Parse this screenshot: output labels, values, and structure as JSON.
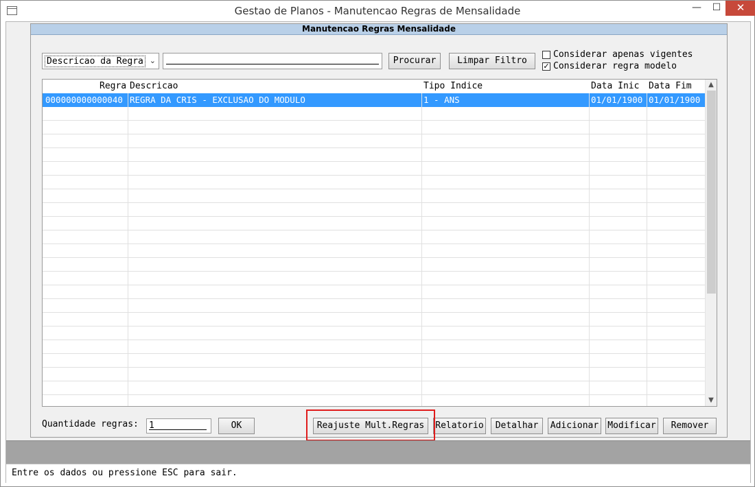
{
  "window": {
    "title": "Gestao de Planos - Manutencao Regras de Mensalidade",
    "min_glyph": "—",
    "max_glyph": "☐",
    "close_glyph": "✕"
  },
  "panel": {
    "title": "Manutencao Regras Mensalidade"
  },
  "filter": {
    "field_selected": "Descricao da Regra",
    "dropdown_glyph": "⌄",
    "search_value": "",
    "search_button": "Procurar",
    "clear_button": "Limpar Filtro",
    "only_current_label": "Considerar apenas vigentes",
    "only_current_checked": false,
    "model_rule_label": "Considerar regra modelo",
    "model_rule_checked": true,
    "check_glyph": "✓"
  },
  "grid": {
    "columns": [
      "Regra",
      "Descricao",
      "Tipo Indice",
      "Data Inic",
      "Data Fim"
    ],
    "rows": [
      {
        "regra": "000000000000040",
        "descricao": "REGRA DA CRIS - EXCLUSAO DO MODULO",
        "tipo_indice": "1 - ANS",
        "data_inic": "01/01/1900",
        "data_fim": "01/01/1900",
        "selected": true
      }
    ],
    "scroll_up_glyph": "▲",
    "scroll_down_glyph": "▼"
  },
  "quantity": {
    "label": "Quantidade regras:",
    "value": "1",
    "ok_button": "OK"
  },
  "actions": {
    "reajuste": "Reajuste Mult.Regras",
    "relatorio": "Relatorio",
    "detalhar": "Detalhar",
    "adicionar": "Adicionar",
    "modificar": "Modificar",
    "remover": "Remover"
  },
  "status": {
    "message": "Entre os dados ou pressione ESC para sair."
  },
  "colors": {
    "selection": "#3399ff",
    "panel_header": "#b9d0e8",
    "highlight": "#e01b1b",
    "close_button": "#c7493a"
  }
}
